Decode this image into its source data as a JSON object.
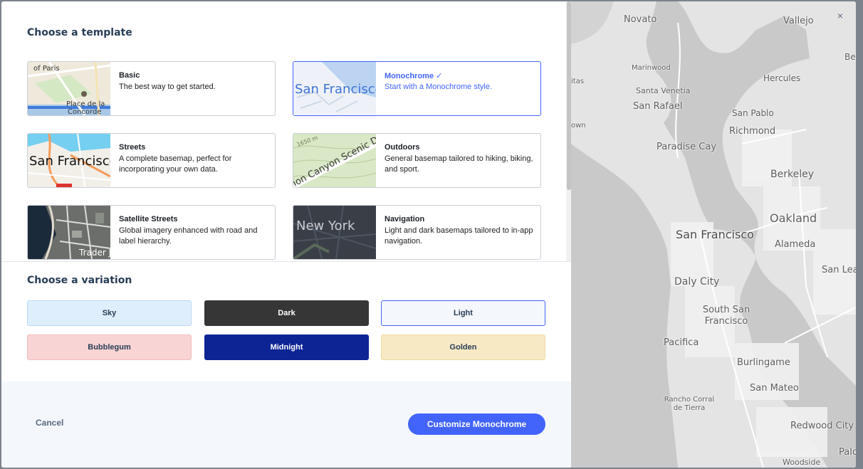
{
  "dialog": {
    "template_heading": "Choose a template",
    "variation_heading": "Choose a variation",
    "close_label": "×"
  },
  "templates": [
    {
      "title": "Basic",
      "desc": "The best way to get started.",
      "thumb_text": "of Paris",
      "thumb_text2": "Place de la Concorde"
    },
    {
      "title": "Monochrome",
      "desc": "Start with a Monochrome style.",
      "thumb_text": "San Francisco",
      "selected": true,
      "check": "✓"
    },
    {
      "title": "Streets",
      "desc": "A complete basemap, perfect for incorporating your own data.",
      "thumb_text": "San Francisco"
    },
    {
      "title": "Outdoors",
      "desc": "General basemap tailored to hiking, biking, and sport.",
      "thumb_text": "ion Canyon Scenic Dr",
      "thumb_text2": "1650 m"
    },
    {
      "title": "Satellite Streets",
      "desc": "Global imagery enhanced with road and label hierarchy.",
      "thumb_text": "Trader J"
    },
    {
      "title": "Navigation",
      "desc": "Light and dark basemaps tailored to in-app navigation.",
      "thumb_text": "New York"
    }
  ],
  "variations": [
    {
      "label": "Sky",
      "bg": "#dfeefc",
      "fg": "#273d56",
      "border": "#b9d7f5"
    },
    {
      "label": "Dark",
      "bg": "#363636",
      "fg": "#ffffff",
      "border": "#363636"
    },
    {
      "label": "Light",
      "bg": "#f4f7fb",
      "fg": "#273d56",
      "border": "#4264fb"
    },
    {
      "label": "Bubblegum",
      "bg": "#f9d4d4",
      "fg": "#273d56",
      "border": "#efbcbc"
    },
    {
      "label": "Midnight",
      "bg": "#0d2494",
      "fg": "#ffffff",
      "border": "#0d2494"
    },
    {
      "label": "Golden",
      "bg": "#f8e9c5",
      "fg": "#273d56",
      "border": "#ecd9a6"
    }
  ],
  "footer": {
    "cancel_label": "Cancel",
    "primary_label": "Customize Monochrome"
  },
  "map_labels": [
    "Novato",
    "Vallejo",
    "Beni",
    "Marinwood",
    "Hercules",
    "itas",
    "Santa Venetia",
    "San Rafael",
    "San Pablo",
    "own",
    "Richmond",
    "Paradise Cay",
    "Berkeley",
    "Oakland",
    "San Francisco",
    "Alameda",
    "San Lea",
    "Daly City",
    "South San Francisco",
    "Pacifica",
    "Burlingame",
    "San Mateo",
    "Rancho Corral de Tierra",
    "Redwood City",
    "Palo A",
    "Woodside"
  ],
  "colors": {
    "accent": "#4264fb",
    "heading": "#273d56",
    "water": "#c8c8c8",
    "land": "#e6e6e6"
  }
}
